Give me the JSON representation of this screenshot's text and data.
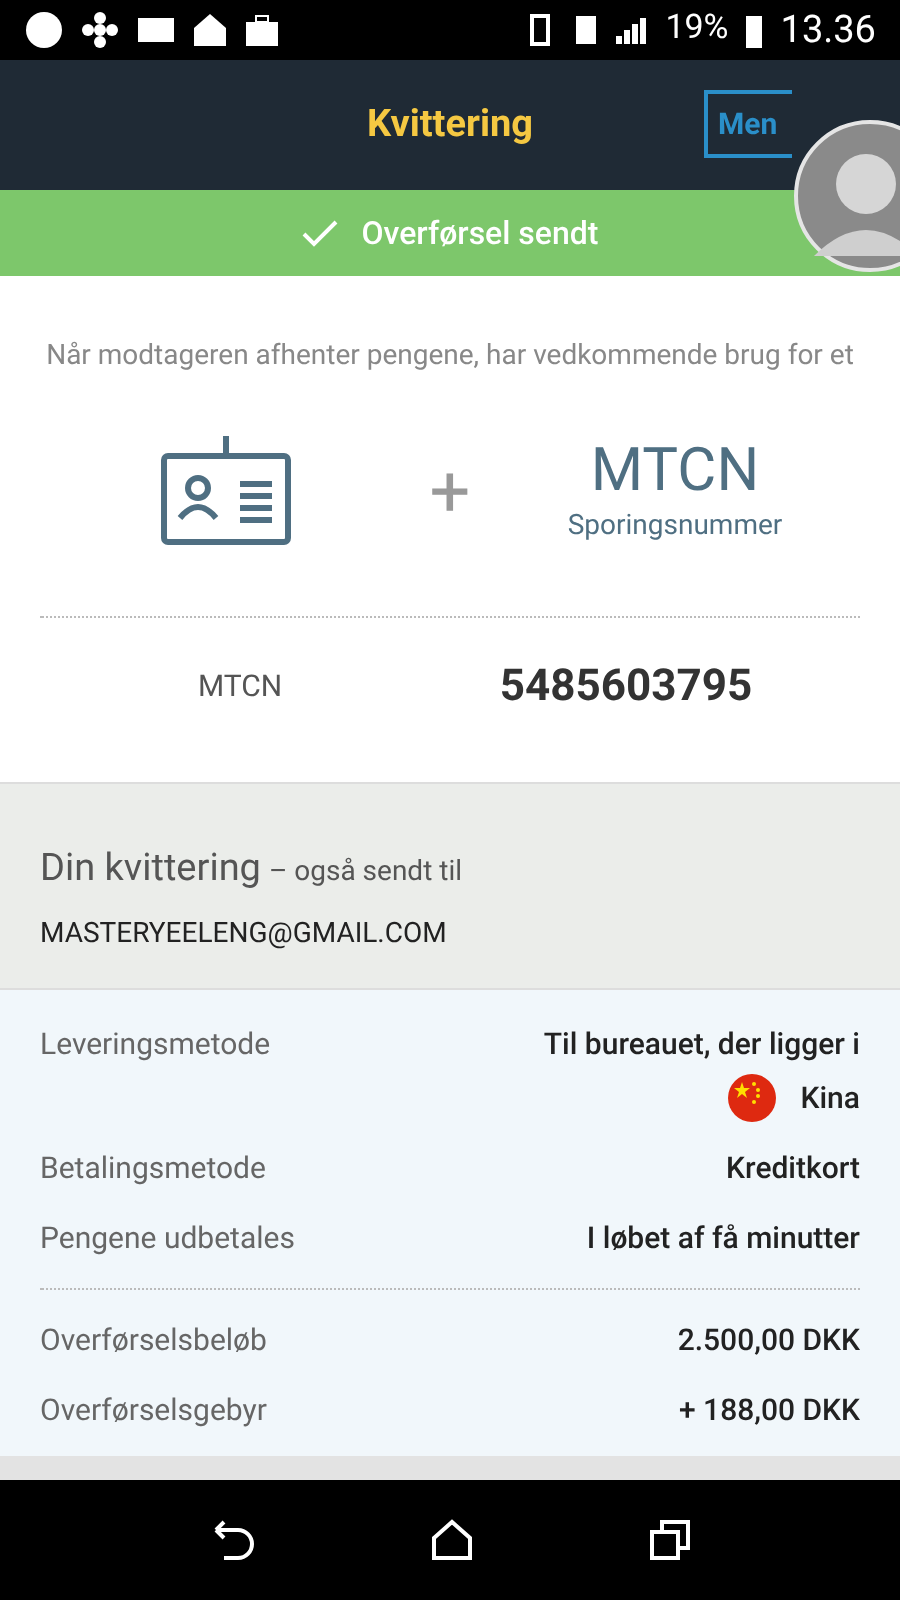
{
  "status_bar": {
    "battery": "19%",
    "time": "13.36"
  },
  "header": {
    "title": "Kvittering",
    "menu_button": "Men"
  },
  "banner": {
    "text": "Overførsel sendt"
  },
  "pickup": {
    "intro": "Når modtageren afhenter pengene, har vedkommende brug for et",
    "plus": "+",
    "code_title": "MTCN",
    "code_subtitle": "Sporingsnummer",
    "mtcn_label": "MTCN",
    "mtcn_value": "5485603795"
  },
  "receipt": {
    "title": "Din kvittering",
    "subtitle": "– også sendt til",
    "email": "MASTERYEELENG@GMAIL.COM"
  },
  "details": [
    {
      "kind": "flag",
      "label": "Leveringsmetode",
      "value": "Til bureauet, der ligger i",
      "extra": "Kina"
    },
    {
      "kind": "plain",
      "label": "Betalingsmetode",
      "value": "Kreditkort"
    },
    {
      "kind": "plain",
      "label": "Pengene udbetales",
      "value": "I løbet af få minutter"
    }
  ],
  "amounts": [
    {
      "label": "Overførselsbeløb",
      "value": "2.500,00 DKK"
    },
    {
      "label": "Overførselsgebyr",
      "value": "+ 188,00 DKK"
    }
  ]
}
